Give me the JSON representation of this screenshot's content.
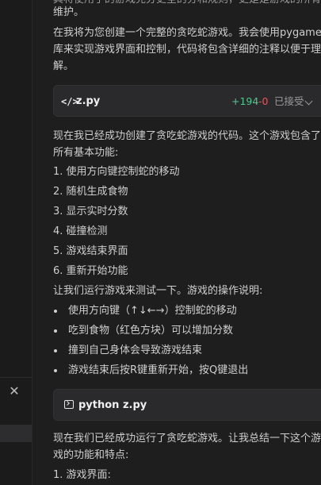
{
  "sidebar": {
    "close_glyph": "✕"
  },
  "chat": {
    "top_partial_1": "具将使用了的游戏完分更全的分和规则，更是是游戏的所有功能",
    "top_partial_2": "维护。",
    "intro_1": "在我将为您创建一个完整的贪吃蛇游戏。我会使用pygame",
    "intro_2": "库来实现游戏界面和控制，代码将包含详细的注释以便于理",
    "intro_3": "解。",
    "file_card": {
      "icon_glyph": "</>",
      "filename": "z.py",
      "added": "+194",
      "removed": "-0",
      "status": "已接受"
    },
    "created_1": "现在我已经成功创建了贪吃蛇游戏的代码。这个游戏包含了",
    "created_2": "所有基本功能:",
    "features": [
      "1. 使用方向键控制蛇的移动",
      "2. 随机生成食物",
      "3. 显示实时分数",
      "4. 碰撞检测",
      "5. 游戏结束界面",
      "6. 重新开始功能"
    ],
    "run_intro": "让我们运行游戏来测试一下。游戏的操作说明:",
    "instructions": [
      "使用方向键（↑↓←→）控制蛇的移动",
      "吃到食物（红色方块）可以增加分数",
      "撞到自己身体会导致游戏结束",
      "游戏结束后按R键重新开始，按Q键退出"
    ],
    "command_card": {
      "command": "python z.py"
    },
    "summary_1": "现在我们已经成功运行了贪吃蛇游戏。让我总结一下这个游",
    "summary_2": "戏的功能和特点:",
    "summary_item_1": "1. 游戏界面:"
  }
}
